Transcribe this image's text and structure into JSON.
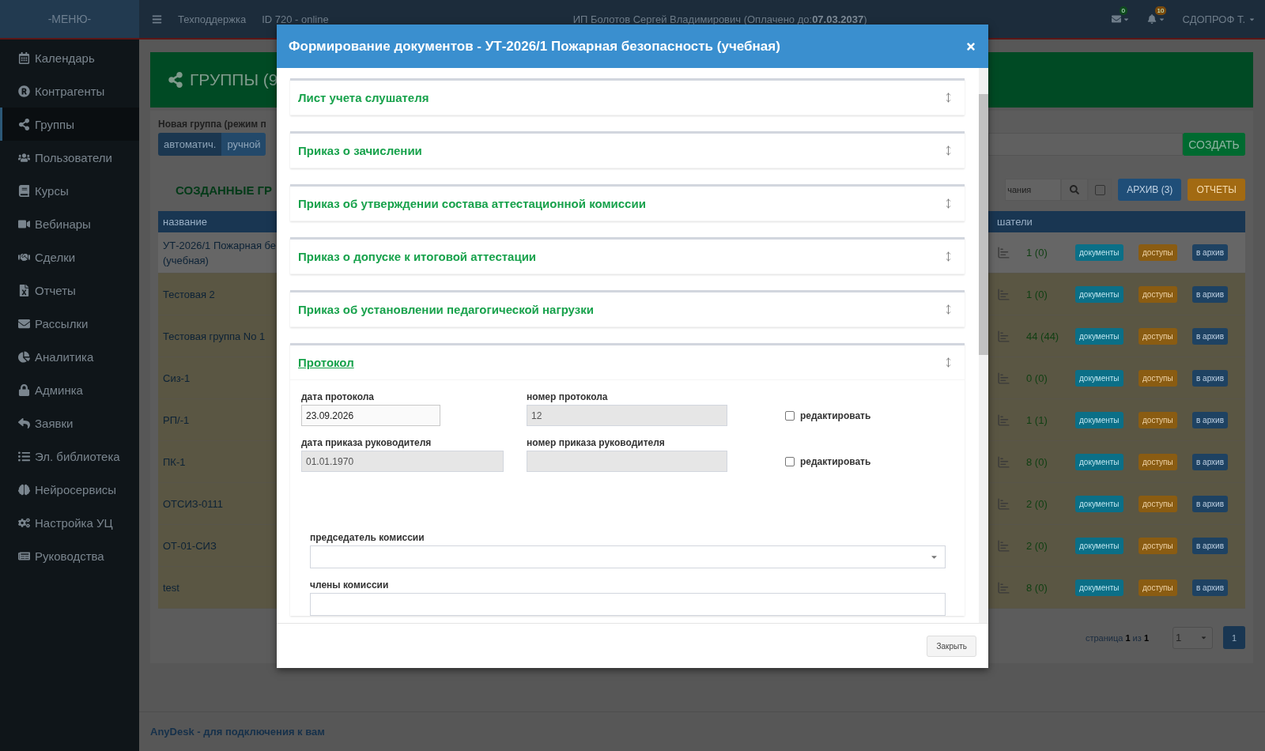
{
  "topbar": {
    "menu_label": "-МЕНЮ-",
    "links": [
      "Техподдержка",
      "ID 720 - online"
    ],
    "owner": "ИП Болотов Сергей Владимирович (Оплачено до:**07.03.2037**)",
    "mail_badge": "0",
    "bell_badge": "10",
    "user": "СДОПРОФ Т."
  },
  "sidebar": {
    "items": [
      {
        "label": "Календарь",
        "selected": false
      },
      {
        "label": "Контрагенты",
        "selected": false
      },
      {
        "label": "Группы",
        "selected": true
      },
      {
        "label": "Пользователи",
        "selected": false
      },
      {
        "label": "Курсы",
        "selected": false
      },
      {
        "label": "Вебинары",
        "selected": false
      },
      {
        "label": "Сделки",
        "selected": false
      },
      {
        "label": "Отчеты",
        "selected": false
      },
      {
        "label": "Рассылки",
        "selected": false
      },
      {
        "label": "Аналитика",
        "selected": false
      },
      {
        "label": "Админка",
        "selected": false
      },
      {
        "label": "Заявки",
        "selected": false
      },
      {
        "label": "Эл. библиотека",
        "selected": false
      },
      {
        "label": "Нейросервисы",
        "selected": false
      },
      {
        "label": "Настройка УЦ",
        "selected": false
      },
      {
        "label": "Руководства",
        "selected": false
      }
    ]
  },
  "page": {
    "title": "ГРУППЫ (9",
    "new_group_label": "Новая группа (режим п",
    "mode_buttons": [
      {
        "label": "автоматич.",
        "selected": true
      },
      {
        "label": "ручной",
        "selected": false
      }
    ],
    "create_button": "СОЗДАТЬ",
    "section_title": "СОЗДАННЫЕ ГР",
    "search_placeholder": "чания",
    "filter_checked": false,
    "archive_button": "АРХИВ (3)",
    "reports_button": "ОТЧЕТЫ",
    "table": {
      "columns": [
        "название",
        "шатели"
      ],
      "rows": [
        {
          "name": [
            "УТ-2026/1 Пожарная бе",
            "(учебная)"
          ],
          "highlighted": false,
          "count": "1 (0)",
          "buttons": [
            "документы",
            "доступы",
            "в архив"
          ]
        },
        {
          "name": [
            "Тестовая 2"
          ],
          "highlighted": true,
          "count": "1 (0)",
          "buttons": [
            "документы",
            "доступы",
            "в архив"
          ]
        },
        {
          "name": [
            "Тестовая группа No 1"
          ],
          "highlighted": true,
          "count": "44 (44)",
          "buttons": [
            "документы",
            "доступы",
            "в архив"
          ]
        },
        {
          "name": [
            "Сиз-1"
          ],
          "highlighted": true,
          "count": "0 (0)",
          "buttons": [
            "документы",
            "доступы",
            "в архив"
          ]
        },
        {
          "name": [
            "РП/-1"
          ],
          "highlighted": true,
          "count": "1 (1)",
          "buttons": [
            "документы",
            "доступы",
            "в архив"
          ]
        },
        {
          "name": [
            "ПК-1"
          ],
          "highlighted": true,
          "count": "8 (0)",
          "buttons": [
            "документы",
            "доступы",
            "в архив"
          ]
        },
        {
          "name": [
            "ОТСИЗ-0111"
          ],
          "highlighted": true,
          "count": "2 (0)",
          "buttons": [
            "документы",
            "доступы",
            "в архив"
          ]
        },
        {
          "name": [
            "ОТ-01-СИЗ"
          ],
          "highlighted": true,
          "count": "2 (0)",
          "buttons": [
            "документы",
            "доступы",
            "в архив"
          ]
        },
        {
          "name": [
            "test"
          ],
          "highlighted": true,
          "count": "8 (0)",
          "buttons": [
            "документы",
            "доступы",
            "в архив"
          ]
        }
      ]
    },
    "pagination": {
      "label": "страница **1** из **1**",
      "select": "1",
      "pages": [
        {
          "label": "1",
          "selected": true
        }
      ]
    }
  },
  "footer": "AnyDesk - для подключения к вам",
  "modal": {
    "title": "Формирование документов - УТ-2026/1 Пожарная безопасность (учебная)",
    "sections": [
      {
        "title": "Лист учета слушателя",
        "expanded": false
      },
      {
        "title": "Приказ о зачислении",
        "expanded": false
      },
      {
        "title": "Приказ об утверждении состава аттестационной комиссии",
        "expanded": false
      },
      {
        "title": "Приказ о допуске к итоговой аттестации",
        "expanded": false
      },
      {
        "title": "Приказ об установлении педагогической нагрузки",
        "expanded": false
      },
      {
        "title": "Протокол",
        "expanded": true
      }
    ],
    "form": {
      "rows": [
        {
          "fields": [
            {
              "label": "дата протокола",
              "value": "23.09.2026",
              "disabled": false
            },
            {
              "label": "номер протокола",
              "value": "12",
              "disabled": true
            }
          ],
          "edit": {
            "label": "редактировать",
            "checked": false
          }
        },
        {
          "fields": [
            {
              "label": "дата приказа руководителя",
              "value": "01.01.1970",
              "disabled": true
            },
            {
              "label": "номер приказа руководителя",
              "disabled": true
            }
          ],
          "edit": {
            "label": "редактировать",
            "checked": false
          }
        }
      ],
      "chair_label": "председатель комиссии",
      "members_label": "члены комиссии"
    },
    "close_button": "Закрыть"
  }
}
